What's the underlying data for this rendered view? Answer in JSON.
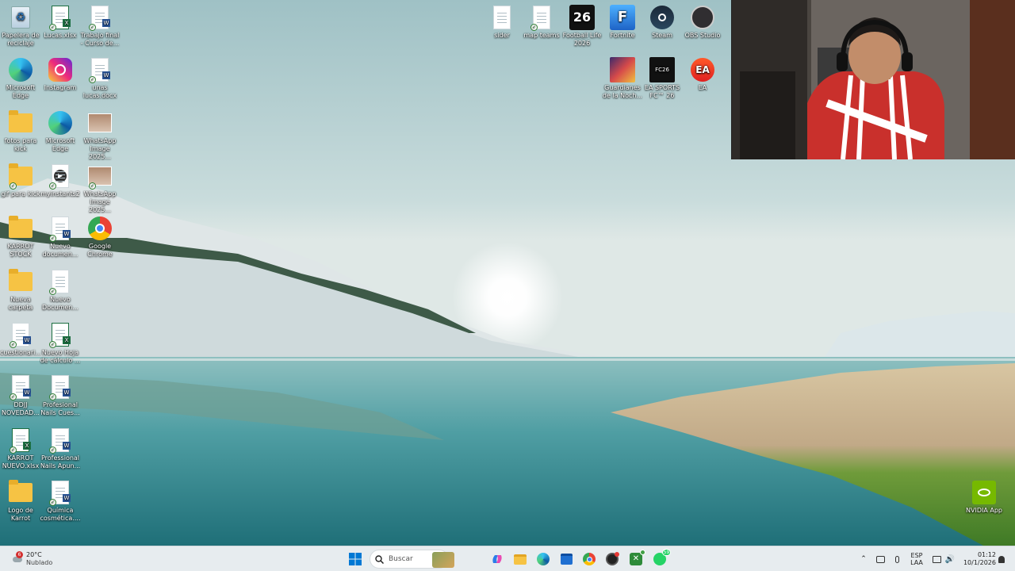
{
  "desktop": {
    "icons": [
      {
        "label": "Papelera de reciclaje",
        "icon": "recycle-bin-icon"
      },
      {
        "label": "Lucas.xlsx",
        "icon": "excel-file-icon"
      },
      {
        "label": "Trabajo final - Curso de...",
        "icon": "word-file-icon"
      },
      {
        "label": "Microsoft Edge",
        "icon": "edge-icon"
      },
      {
        "label": "Instagram",
        "icon": "instagram-icon"
      },
      {
        "label": "unas lucas.docx",
        "icon": "word-file-icon"
      },
      {
        "label": "fotos para kick",
        "icon": "folder-icon"
      },
      {
        "label": "Microsoft Edge",
        "icon": "edge-icon"
      },
      {
        "label": "WhatsApp Image 2025...",
        "icon": "image-file-icon"
      },
      {
        "label": "gif para kick",
        "icon": "folder-icon"
      },
      {
        "label": "myinstants2",
        "icon": "media-file-icon"
      },
      {
        "label": "WhatsApp Image 2025...",
        "icon": "image-file-icon"
      },
      {
        "label": "KARROT STOCK",
        "icon": "folder-icon"
      },
      {
        "label": "Nuevo documen...",
        "icon": "word-file-icon"
      },
      {
        "label": "Google Chrome",
        "icon": "chrome-icon"
      },
      {
        "label": "Nueva carpeta",
        "icon": "folder-icon"
      },
      {
        "label": "Nuevo Documen...",
        "icon": "text-file-icon"
      },
      {
        "label": "cuestionari...",
        "icon": "word-file-icon"
      },
      {
        "label": "Nuevo Hoja de cálculo ...",
        "icon": "excel-file-icon"
      },
      {
        "label": "DDJJ NOVEDAD...",
        "icon": "word-file-icon"
      },
      {
        "label": "Profesional Nails Cues...",
        "icon": "word-file-icon"
      },
      {
        "label": "KARROT NUEVO.xlsx",
        "icon": "excel-file-icon"
      },
      {
        "label": "Professional Nails Apun...",
        "icon": "word-file-icon"
      },
      {
        "label": "Logo de Karrot",
        "icon": "folder-icon"
      },
      {
        "label": "Química cosmética....",
        "icon": "word-file-icon"
      },
      {
        "label": "sider",
        "icon": "file-icon"
      },
      {
        "label": "map teams",
        "icon": "file-icon"
      },
      {
        "label": "Football Life 2026",
        "icon": "football-life-icon"
      },
      {
        "label": "Fortnite",
        "icon": "fortnite-icon"
      },
      {
        "label": "Steam",
        "icon": "steam-icon"
      },
      {
        "label": "OBS Studio",
        "icon": "obs-icon"
      },
      {
        "label": "Guardianes de la Noch...",
        "icon": "game-icon"
      },
      {
        "label": "EA SPORTS FC™ 26",
        "icon": "fc26-icon"
      },
      {
        "label": "EA",
        "icon": "ea-icon"
      },
      {
        "label": "NVIDIA App",
        "icon": "nvidia-icon"
      }
    ]
  },
  "badges": {
    "football_life": "26",
    "ea": "EA",
    "fc": "FC26"
  },
  "taskbar": {
    "weather_badge": "6",
    "weather_temp": "20°C",
    "weather_desc": "Nublado",
    "search_placeholder": "Buscar",
    "whatsapp_badge": "59",
    "lang_top": "ESP",
    "lang_bottom": "LAA",
    "time": "01:12",
    "date": "10/1/2026"
  },
  "colors": {
    "taskbar": "#e7ecef",
    "accent": "#0078d4"
  }
}
